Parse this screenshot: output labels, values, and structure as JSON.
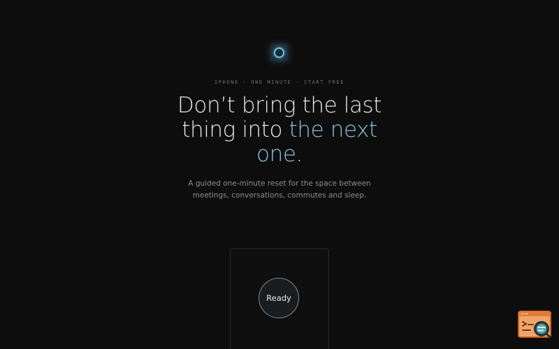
{
  "hero": {
    "eyebrow": "IPHONE · ONE MINUTE · START FREE",
    "headline_part1": "Don’t bring the last thing into ",
    "headline_accent": "the next one",
    "headline_end": ".",
    "subline": "A guided one-minute reset for the space between meetings, conversations, commutes and sleep."
  },
  "card": {
    "button_label": "Ready"
  },
  "colors": {
    "background": "#0d0d0e",
    "accent": "#8ec0d6",
    "widget_orange": "#e07a3c"
  },
  "icons": {
    "logo": "breathing-ring-icon",
    "corner_widget": "browser-search-icon"
  }
}
